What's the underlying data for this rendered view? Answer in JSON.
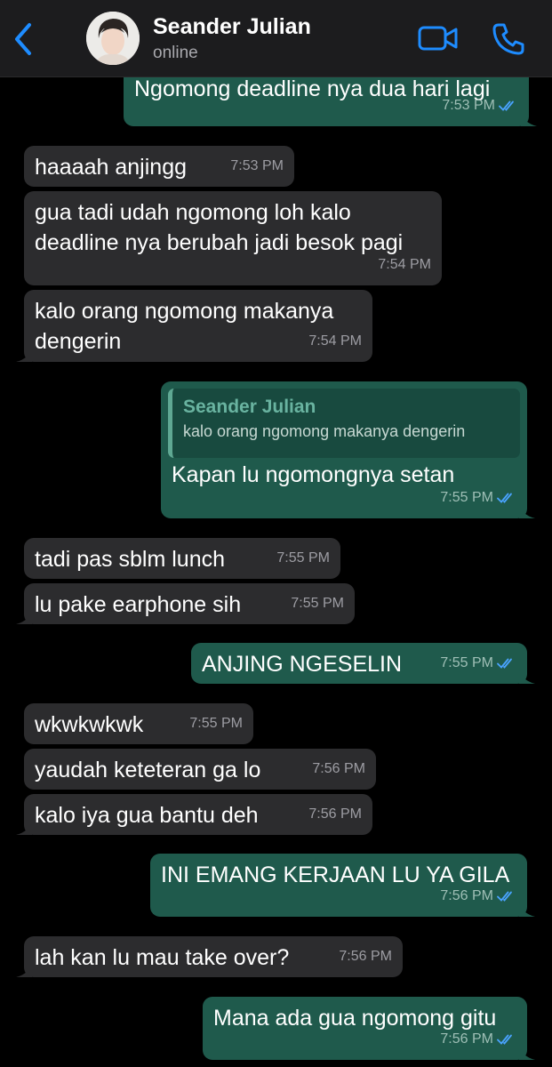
{
  "header": {
    "contact_name": "Seander Julian",
    "status": "online",
    "back_icon": "chevron-left-icon",
    "video_icon": "video-camera-icon",
    "call_icon": "phone-icon",
    "accent_color": "#1e8cff"
  },
  "messages": [
    {
      "direction": "out",
      "text": "Ngomong deadline nya dua hari lagi",
      "time": "7:53 PM",
      "read": true
    },
    {
      "direction": "in",
      "text": "haaaah anjingg",
      "time": "7:53 PM"
    },
    {
      "direction": "in",
      "lines": [
        "gua tadi udah ngomong loh kalo",
        "deadline nya berubah jadi besok pagi"
      ],
      "time": "7:54 PM"
    },
    {
      "direction": "in",
      "lines": [
        "kalo orang ngomong makanya",
        "dengerin"
      ],
      "time": "7:54 PM"
    },
    {
      "direction": "out",
      "quote": {
        "name": "Seander Julian",
        "text": "kalo orang ngomong makanya dengerin"
      },
      "text": "Kapan lu ngomongnya setan",
      "time": "7:55 PM",
      "read": true
    },
    {
      "direction": "in",
      "text": "tadi pas sblm lunch",
      "time": "7:55 PM"
    },
    {
      "direction": "in",
      "text": "lu pake earphone sih",
      "time": "7:55 PM"
    },
    {
      "direction": "out",
      "text": "ANJING NGESELIN",
      "time": "7:55 PM",
      "read": true
    },
    {
      "direction": "in",
      "text": "wkwkwkwk",
      "time": "7:55 PM"
    },
    {
      "direction": "in",
      "text": "yaudah keteteran ga lo",
      "time": "7:56 PM"
    },
    {
      "direction": "in",
      "text": "kalo iya gua bantu deh",
      "time": "7:56 PM"
    },
    {
      "direction": "out",
      "text": "INI EMANG KERJAAN LU YA GILA",
      "time": "7:56 PM",
      "read": true
    },
    {
      "direction": "in",
      "text": "lah kan lu mau take over?",
      "time": "7:56 PM"
    },
    {
      "direction": "out",
      "text": "Mana ada gua ngomong gitu",
      "time": "7:56 PM",
      "read": true
    }
  ]
}
